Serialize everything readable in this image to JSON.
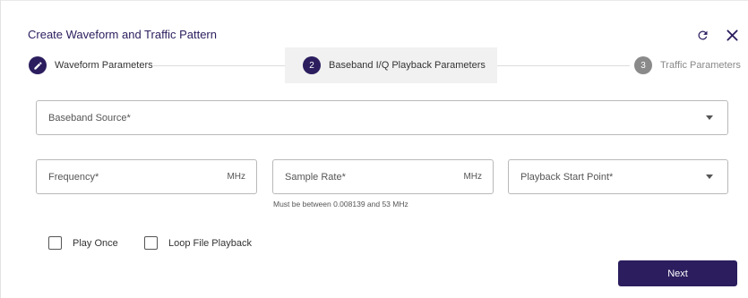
{
  "dialog": {
    "title": "Create Waveform and Traffic Pattern"
  },
  "stepper": {
    "steps": [
      {
        "number": "1",
        "label": "Waveform Parameters",
        "state": "completed"
      },
      {
        "number": "2",
        "label": "Baseband I/Q Playback Parameters",
        "state": "active"
      },
      {
        "number": "3",
        "label": "Traffic Parameters",
        "state": "pending"
      }
    ]
  },
  "form": {
    "baseband_source": {
      "label": "Baseband Source*"
    },
    "frequency": {
      "label": "Frequency*",
      "unit": "MHz"
    },
    "sample_rate": {
      "label": "Sample Rate*",
      "unit": "MHz",
      "hint": "Must be between 0.008139 and 53 MHz"
    },
    "playback_start_point": {
      "label": "Playback Start Point*"
    },
    "play_once": {
      "label": "Play Once",
      "checked": false
    },
    "loop_file_playback": {
      "label": "Loop File Playback",
      "checked": false
    }
  },
  "actions": {
    "next_label": "Next"
  },
  "colors": {
    "primary": "#2b1d5e",
    "pending_step": "#8a8a8a",
    "active_step_bg": "#f1f1f1",
    "field_border": "#b9b9b9"
  },
  "icons": {
    "refresh": "refresh-icon",
    "close": "close-icon",
    "step_completed": "pencil-icon",
    "dropdown": "caret-down-icon"
  }
}
